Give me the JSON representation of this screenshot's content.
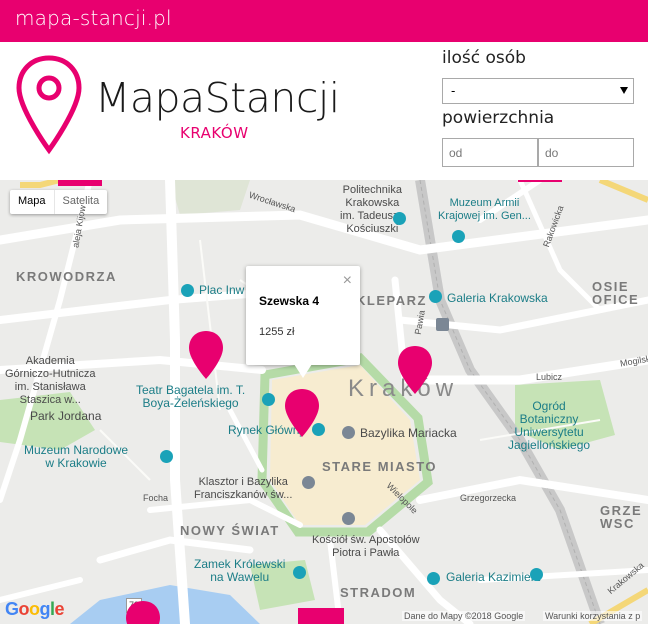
{
  "site": {
    "domain": "mapa-stancji.pl"
  },
  "brand": {
    "name": "MapaStancji",
    "city": "KRAKÓW"
  },
  "filters": {
    "people_label": "ilość osób",
    "people_value": "-",
    "area_label": "powierzchnia",
    "area_from_placeholder": "od",
    "area_to_placeholder": "do"
  },
  "map": {
    "type_buttons": [
      "Mapa",
      "Satelita"
    ],
    "labels": {
      "politechnika": "Politechnika\nKrakowska\nim. Tadeusza\nKościuszki",
      "muzeum_armii": "Muzeum Armii\nKrajowej im. Gen...",
      "wroclawska": "Wrocławska",
      "rakowicka": "Rakowicka",
      "krowodrza": "KROWODRZA",
      "plac_inwalidow": "Plac Inw",
      "kleparz": "KLEPARZ",
      "galeria_krakowska": "Galeria Krakowska",
      "osiedle": "OSIE\nOFICE",
      "mogilska": "Mogilsk",
      "akademia": "Akademia\nGórniczo-Hutnicza\nim. Stanisława\nStaszica w...",
      "park_jordana": "Park Jordana",
      "teatr": "Teatr Bagatela im. T.\nBoya-Żeleńskiego",
      "krakow": "Kraków",
      "lubicz": "Lubicz",
      "ogrod": "Ogród\nBotaniczny\nUniwersytetu\nJagiellońskiego",
      "rynek": "Rynek Główny",
      "bazylika": "Bazylika Mariacka",
      "muzeum_narodowe": "Muzeum Narodowe\nw Krakowie",
      "stare_miasto": "STARE MIASTO",
      "klasztor": "Klasztor i Bazylika\nFranciszkanów św...",
      "focha": "Focha",
      "nowy_swiat": "NOWY ŚWIAT",
      "wielopole": "Wielopole",
      "grzegorzecka": "Grzegorzecka",
      "grzegorzki": "GRZE\nWSC",
      "kosciol": "Kościół św. Apostołów\nPiotra i Pawła",
      "zamek": "Zamek Królewski\nna Wawelu",
      "galeria_kazimierz": "Galeria Kazimierz",
      "stradom": "STRADOM",
      "krakowska_str": "Krakowska",
      "pawia": "Pawia",
      "aleja": "aleja Kijow",
      "road_79": "79"
    },
    "infowindow": {
      "title": "Szewska 4",
      "price": "1255 zł",
      "close": "×"
    },
    "attribution": {
      "logo": "Google",
      "data": "Dane do Mapy ©2018 Google",
      "terms": "Warunki korzystania z p"
    },
    "pin_color": "#e8006f"
  },
  "colors": {
    "accent": "#e8006f",
    "poi": "#1aa2b8"
  }
}
